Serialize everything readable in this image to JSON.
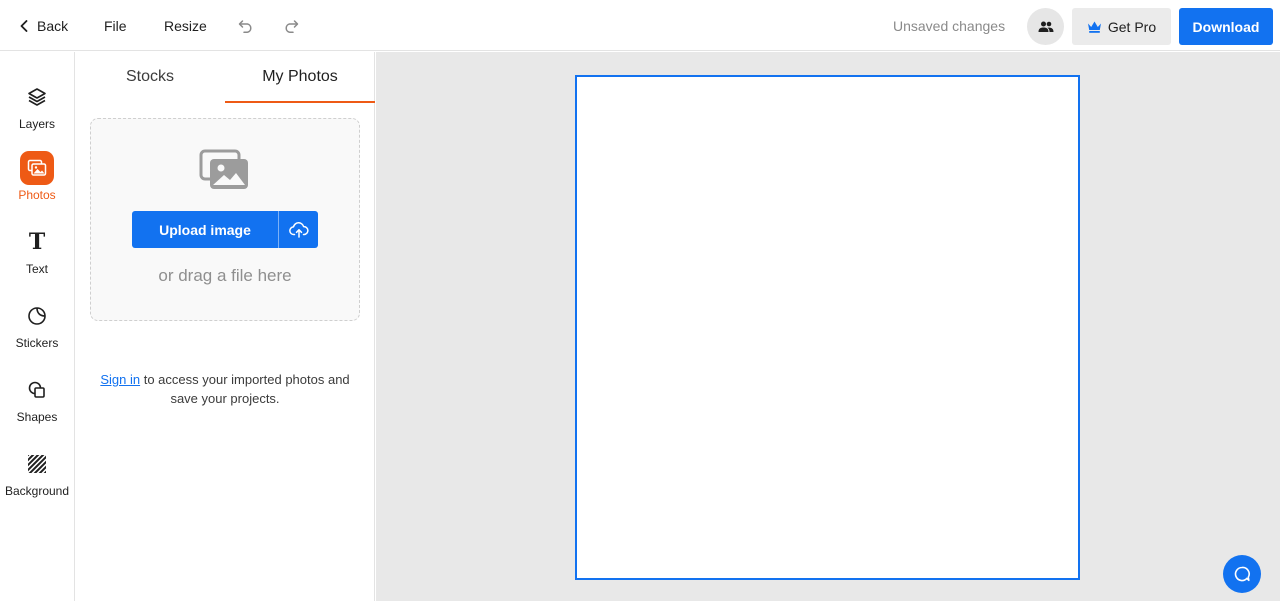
{
  "topbar": {
    "back_label": "Back",
    "file_label": "File",
    "resize_label": "Resize",
    "undo_icon": "undo-icon",
    "redo_icon": "redo-icon",
    "unsaved_text": "Unsaved changes",
    "collab_icon": "people-icon",
    "getpro_label": "Get Pro",
    "download_label": "Download"
  },
  "rail": {
    "items": [
      {
        "label": "Layers",
        "icon": "layers-icon"
      },
      {
        "label": "Photos",
        "icon": "photos-icon",
        "active": true
      },
      {
        "label": "Text",
        "icon": "text-icon"
      },
      {
        "label": "Stickers",
        "icon": "sticker-icon"
      },
      {
        "label": "Shapes",
        "icon": "shapes-icon"
      },
      {
        "label": "Background",
        "icon": "background-pattern-icon"
      }
    ]
  },
  "panel": {
    "tabs": [
      {
        "label": "Stocks"
      },
      {
        "label": "My Photos",
        "active": true
      }
    ],
    "upload_label": "Upload image",
    "drag_text": "or drag a file here",
    "signin_link": "Sign in",
    "signin_text": " to access your imported photos and save your projects."
  },
  "colors": {
    "accent": "#1272f0",
    "active": "#ee5a15",
    "canvas_bg": "#e8e8e8"
  }
}
